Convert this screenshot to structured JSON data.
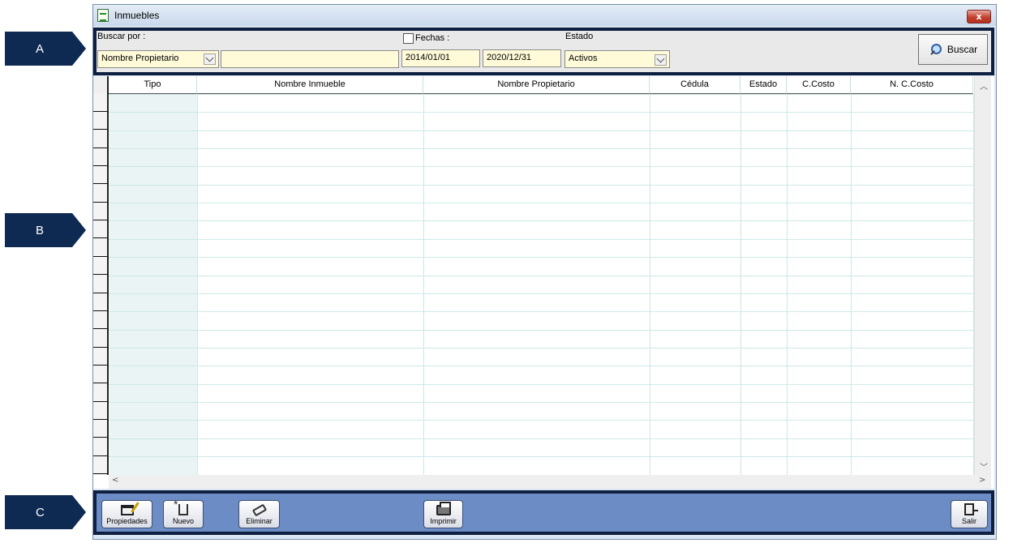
{
  "callouts": {
    "a": "A",
    "b": "B",
    "c": "C"
  },
  "window": {
    "title": "Inmuebles",
    "close_glyph": "x"
  },
  "search": {
    "buscar_por_label": "Buscar por :",
    "buscar_por_value": "Nombre Propietario",
    "search_text_value": "",
    "fechas_label": "Fechas :",
    "fechas_checked": false,
    "fecha_desde": "2014/01/01",
    "fecha_hasta": "2020/12/31",
    "estado_label": "Estado",
    "estado_value": "Activos",
    "buscar_button": "Buscar"
  },
  "grid": {
    "columns": [
      "Tipo",
      "Nombre Inmueble",
      "Nombre Propietario",
      "Cédula",
      "Estado",
      "C.Costo",
      "N. C.Costo"
    ],
    "rows": []
  },
  "toolbar": {
    "propiedades": "Propiedades",
    "nuevo": "Nuevo",
    "eliminar": "Eliminar",
    "imprimir": "Imprimir",
    "salir": "Salir"
  },
  "colors": {
    "callout": "#0e2a52",
    "frame_border": "#0e1f40",
    "toolbar_bg": "#6b8cc4",
    "input_bg": "#fffbd8",
    "tipo_col_bg": "#eaf4f4"
  },
  "icons": {
    "window": "form-icon",
    "buscar": "search-lens-icon",
    "propiedades": "properties-icon",
    "nuevo": "new-document-icon",
    "eliminar": "eraser-icon",
    "imprimir": "printer-icon",
    "salir": "exit-door-icon"
  }
}
